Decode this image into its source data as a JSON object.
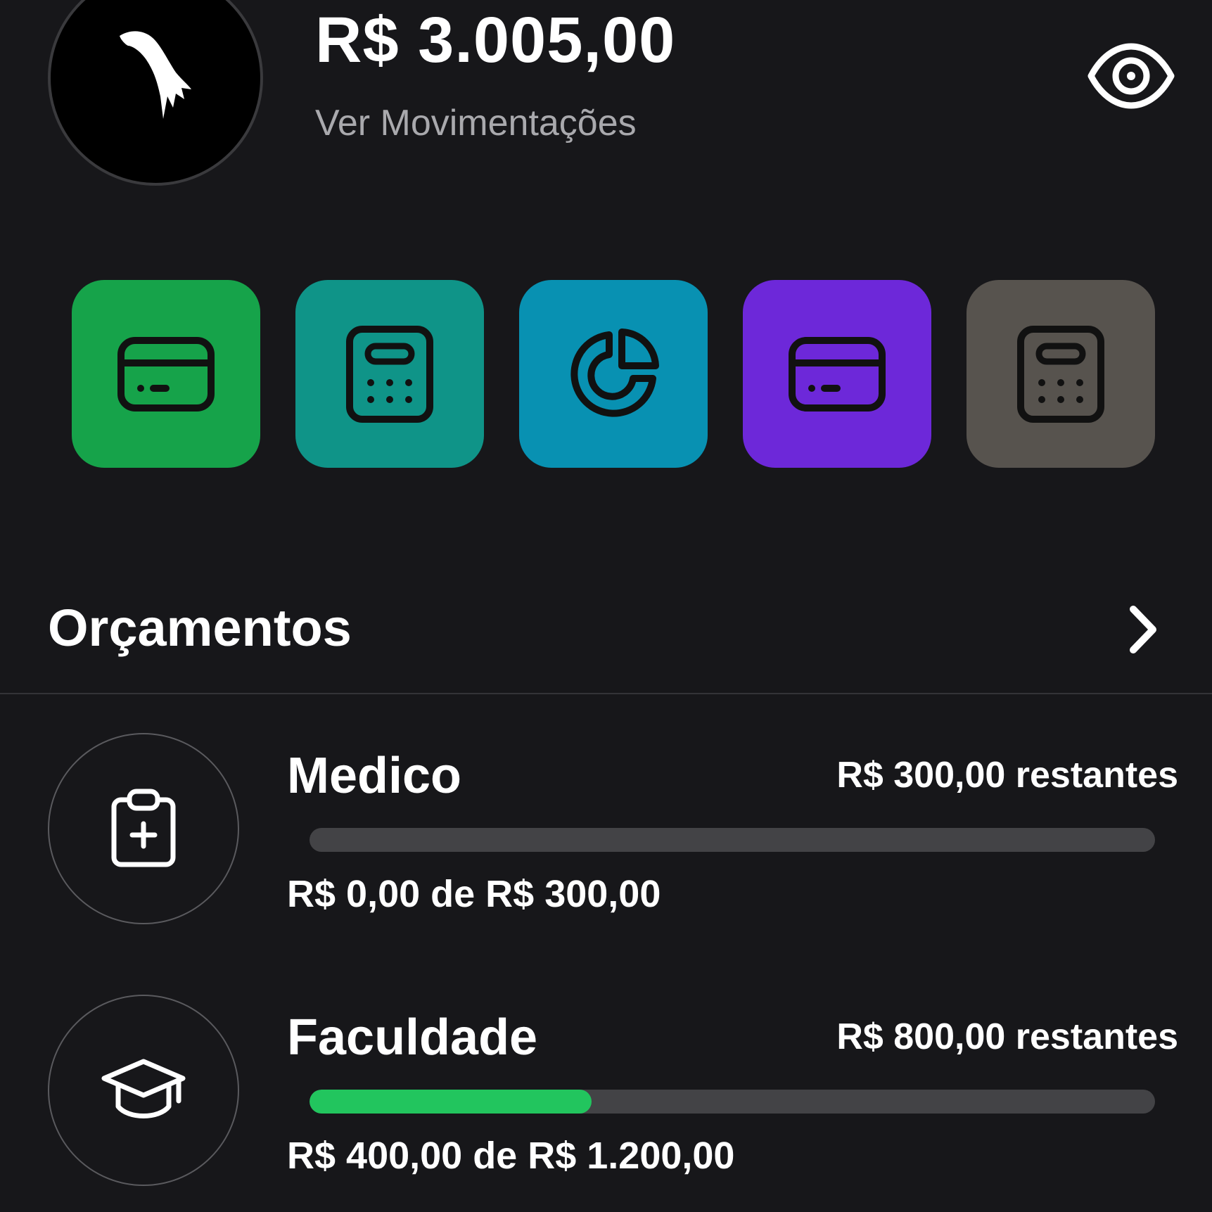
{
  "header": {
    "balance": "R$ 3.005,00",
    "movements_link": "Ver Movimentações",
    "avatar_icon": "bird-logo-icon",
    "visibility_icon": "eye-icon"
  },
  "shortcuts": [
    {
      "icon": "credit-card-icon",
      "color": "#16a34a"
    },
    {
      "icon": "calculator-icon",
      "color": "#0f9488"
    },
    {
      "icon": "pie-chart-icon",
      "color": "#0891b2"
    },
    {
      "icon": "credit-card-icon",
      "color": "#6d28d9"
    },
    {
      "icon": "calculator-icon",
      "color": "#57534e"
    }
  ],
  "budgets": {
    "title": "Orçamentos",
    "arrow_icon": "chevron-right-icon",
    "items": [
      {
        "name": "Medico",
        "remaining": "R$ 300,00 restantes",
        "amounts": "R$ 0,00 de R$ 300,00",
        "progress": 0,
        "icon": "clipboard-plus-icon"
      },
      {
        "name": "Faculdade",
        "remaining": "R$ 800,00 restantes",
        "amounts": "R$ 400,00 de R$ 1.200,00",
        "progress": 0.3333,
        "icon": "graduation-cap-icon"
      }
    ]
  },
  "colors": {
    "background": "#17171a",
    "progress_fill": "#22c55e",
    "progress_track": "#434346"
  }
}
